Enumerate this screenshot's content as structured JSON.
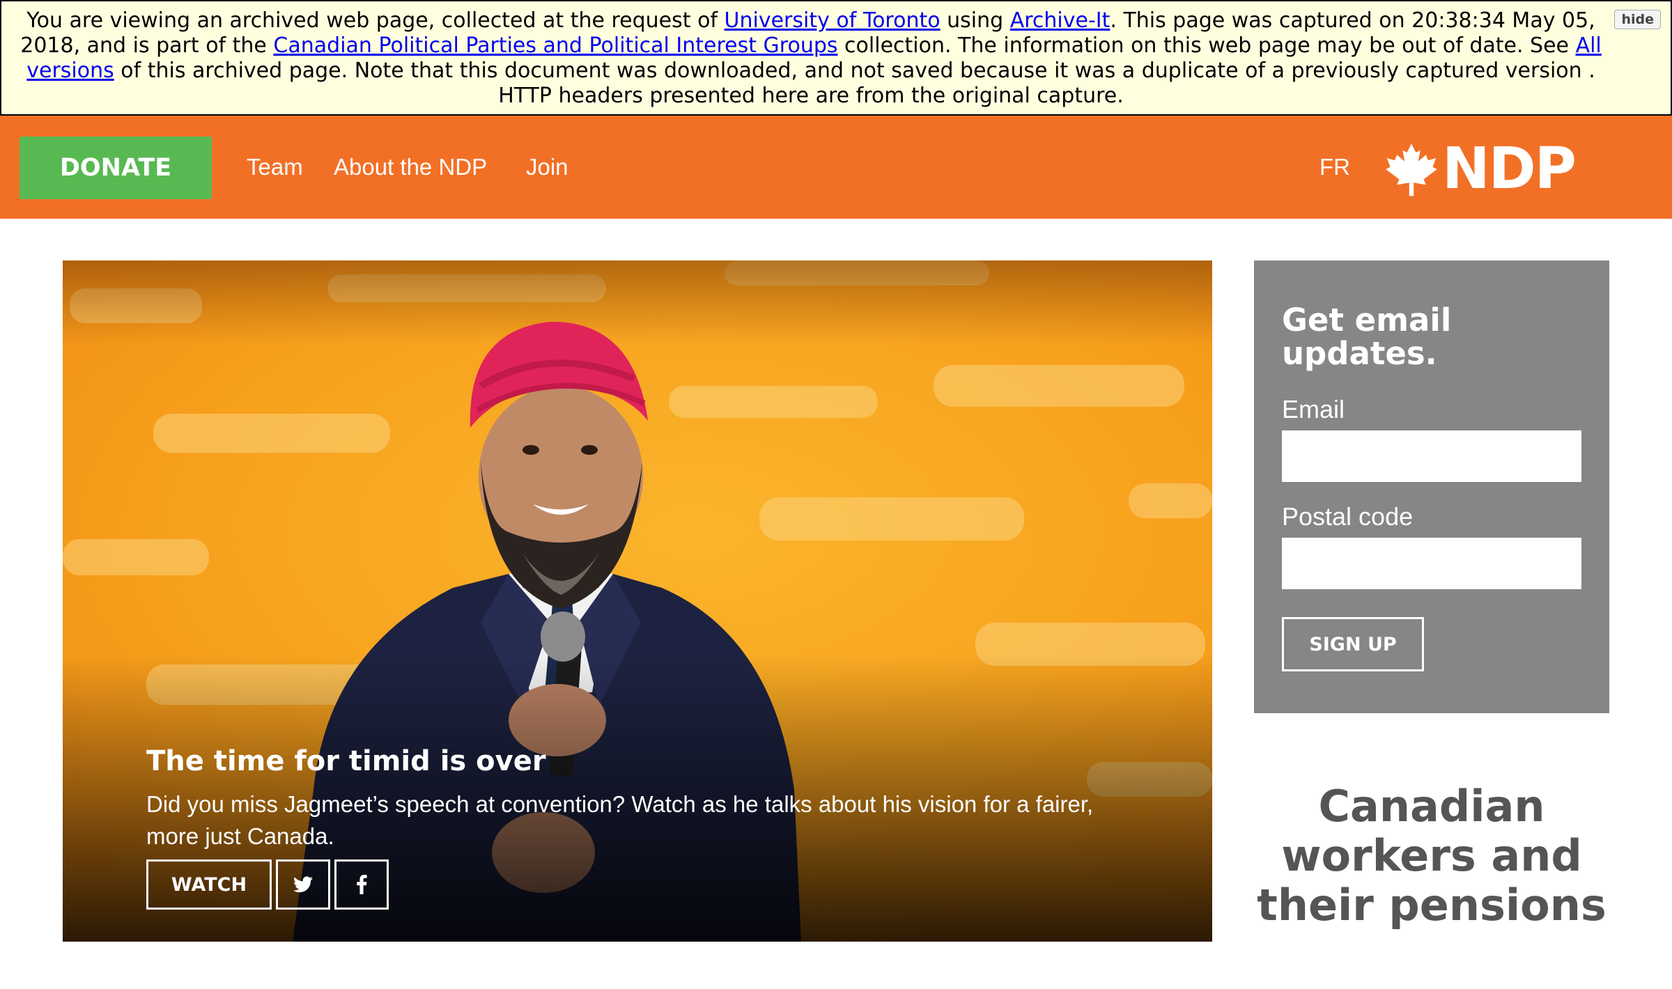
{
  "archive_banner": {
    "t1": "You are viewing an archived web page, collected at the request of ",
    "link_university": "University of Toronto",
    "t2": " using ",
    "link_archive_it": "Archive-It",
    "t3": ". This page was captured on 20:38:34 May 05, 2018, and is part of the ",
    "link_collection": "Canadian Political Parties and Political Interest Groups",
    "t4": " collection. The information on this web page may be out of date. See ",
    "link_all_versions": "All versions",
    "t5": " of this archived page. Note that this document was downloaded, and not saved because it was a duplicate of a previously captured version . HTTP headers presented here are from the original capture.",
    "hide_label": "hide"
  },
  "nav": {
    "donate_label": "DONATE",
    "links": [
      "Team",
      "About the NDP",
      "Join"
    ],
    "lang_label": "FR",
    "logo_text": "NDP",
    "logo_icon": "maple-leaf-icon",
    "background_color": "#f27026",
    "donate_color": "#58b953"
  },
  "hero": {
    "title": "The time for timid is over",
    "description": "Did you miss Jagmeet’s speech at convention? Watch as he talks about his vision for a fairer, more just Canada.",
    "watch_label": "WATCH",
    "share_icons": [
      "twitter-icon",
      "facebook-icon"
    ]
  },
  "signup": {
    "title": "Get email updates.",
    "email_label": "Email",
    "email_value": "",
    "postal_label": "Postal code",
    "postal_value": "",
    "button_label": "SIGN UP",
    "panel_color": "#868686"
  },
  "side_headline": "Canadian workers and their pensions"
}
